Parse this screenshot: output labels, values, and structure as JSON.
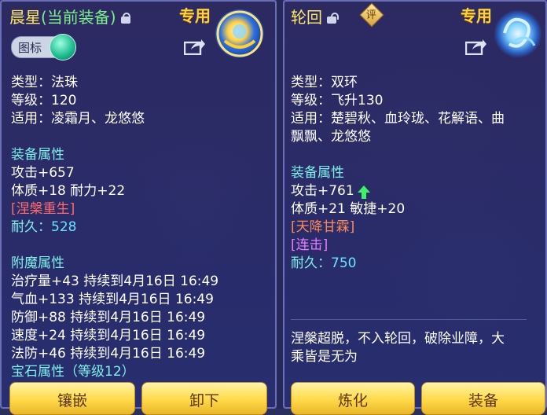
{
  "left": {
    "title_name": "晨星",
    "title_paren": "(当前装备)",
    "tag": "专用",
    "icon_toggle_label": "图标",
    "type_line": "类型：法珠",
    "level_line": "等级：120",
    "usable_line": "适用：凌霜月、龙悠悠",
    "section_attr": "装备属性",
    "attack": "攻击+657",
    "stats": "体质+18 耐力+22",
    "special": "[涅槃重生]",
    "durability_label": "耐久：",
    "durability_value": "528",
    "section_enchant": "附魔属性",
    "enchants": [
      "治疗量+43 持续到4月16日 16:49",
      "气血+133 持续到4月16日 16:49",
      "防御+88 持续到4月16日 16:49",
      "速度+24 持续到4月16日 16:49",
      "法防+46 持续到4月16日 16:49"
    ],
    "gem_line": "宝石属性（等级12）",
    "btn_inlay": "镶嵌",
    "btn_remove": "卸下"
  },
  "right": {
    "title_name": "轮回",
    "rating_glyph": "评",
    "tag": "专用",
    "type_line": "类型：双环",
    "level_line": "等级：飞升130",
    "usable_line1": "适用：楚碧秋、血玲珑、花解语、曲",
    "usable_line2": "飘飘、龙悠悠",
    "section_attr": "装备属性",
    "attack": "攻击+761",
    "stats": "体质+21 敏捷+20",
    "special1": "[天降甘霖]",
    "special2": "[连击]",
    "durability_label": "耐久：",
    "durability_value": "750",
    "desc1": "涅槃超脱，不入轮回，破除业障，大",
    "desc2": "乘皆是无为",
    "btn_refine": "炼化",
    "btn_equip": "装备"
  },
  "colors": {
    "title": "#ffe866",
    "section": "#7ef2ea",
    "durability": "#69e4ff",
    "button": "#ffd948"
  },
  "icons": [
    "lock-icon",
    "unlock-icon",
    "share-icon",
    "rating-icon",
    "orb-item-icon",
    "ring-item-icon",
    "up-arrow-icon"
  ]
}
